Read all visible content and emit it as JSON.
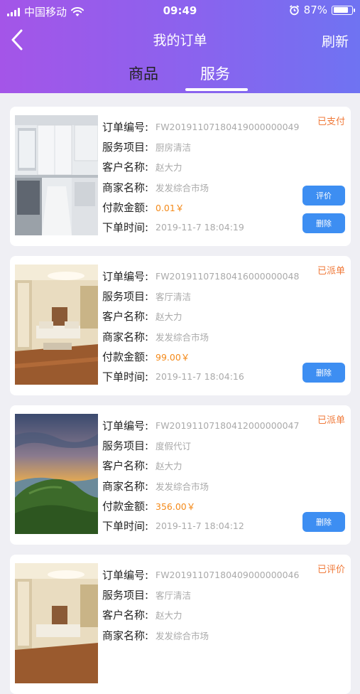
{
  "status_bar": {
    "carrier": "中国移动",
    "time": "09:49",
    "battery": "87%",
    "battery_level": 0.87
  },
  "nav": {
    "title": "我的订单",
    "refresh_label": "刷新"
  },
  "tabs": [
    {
      "label": "商品"
    },
    {
      "label": "服务"
    }
  ],
  "labels": {
    "order_no": "订单编号:",
    "service_item": "服务项目:",
    "customer": "客户名称:",
    "merchant": "商家名称:",
    "amount": "付款金额:",
    "order_time": "下单时间:"
  },
  "orders": [
    {
      "status": "已支付",
      "order_no": "FW20191107180419000000049",
      "service_item": "厨房清洁",
      "customer": "赵大力",
      "merchant": "发发综合市场",
      "amount": "0.01￥",
      "order_time": "2019-11-7 18:04:19",
      "review_label": "评价",
      "delete_label": "删除"
    },
    {
      "status": "已派单",
      "order_no": "FW20191107180416000000048",
      "service_item": "客厅清洁",
      "customer": "赵大力",
      "merchant": "发发综合市场",
      "amount": "99.00￥",
      "order_time": "2019-11-7 18:04:16",
      "delete_label": "删除"
    },
    {
      "status": "已派单",
      "order_no": "FW20191107180412000000047",
      "service_item": "度假代订",
      "customer": "赵大力",
      "merchant": "发发综合市场",
      "amount": "356.00￥",
      "order_time": "2019-11-7 18:04:12",
      "delete_label": "删除"
    },
    {
      "status": "已评价",
      "order_no": "FW20191107180409000000046",
      "service_item": "客厅清洁",
      "customer": "赵大力",
      "merchant": "发发综合市场"
    }
  ]
}
